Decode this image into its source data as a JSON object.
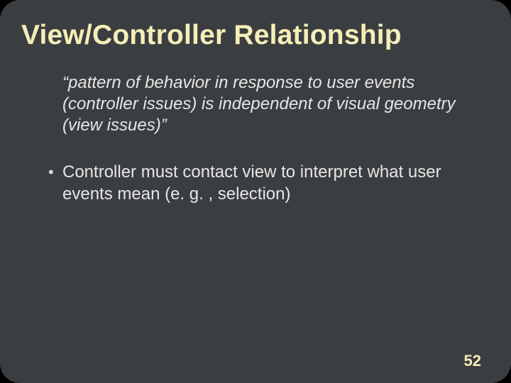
{
  "slide": {
    "title": "View/Controller Relationship",
    "quote": "“pattern of behavior in response to user events (controller issues) is independent of visual geometry (view issues)”",
    "bullets": [
      "Controller must contact view to interpret what user events mean (e. g. , selection)"
    ],
    "page_number": "52"
  }
}
